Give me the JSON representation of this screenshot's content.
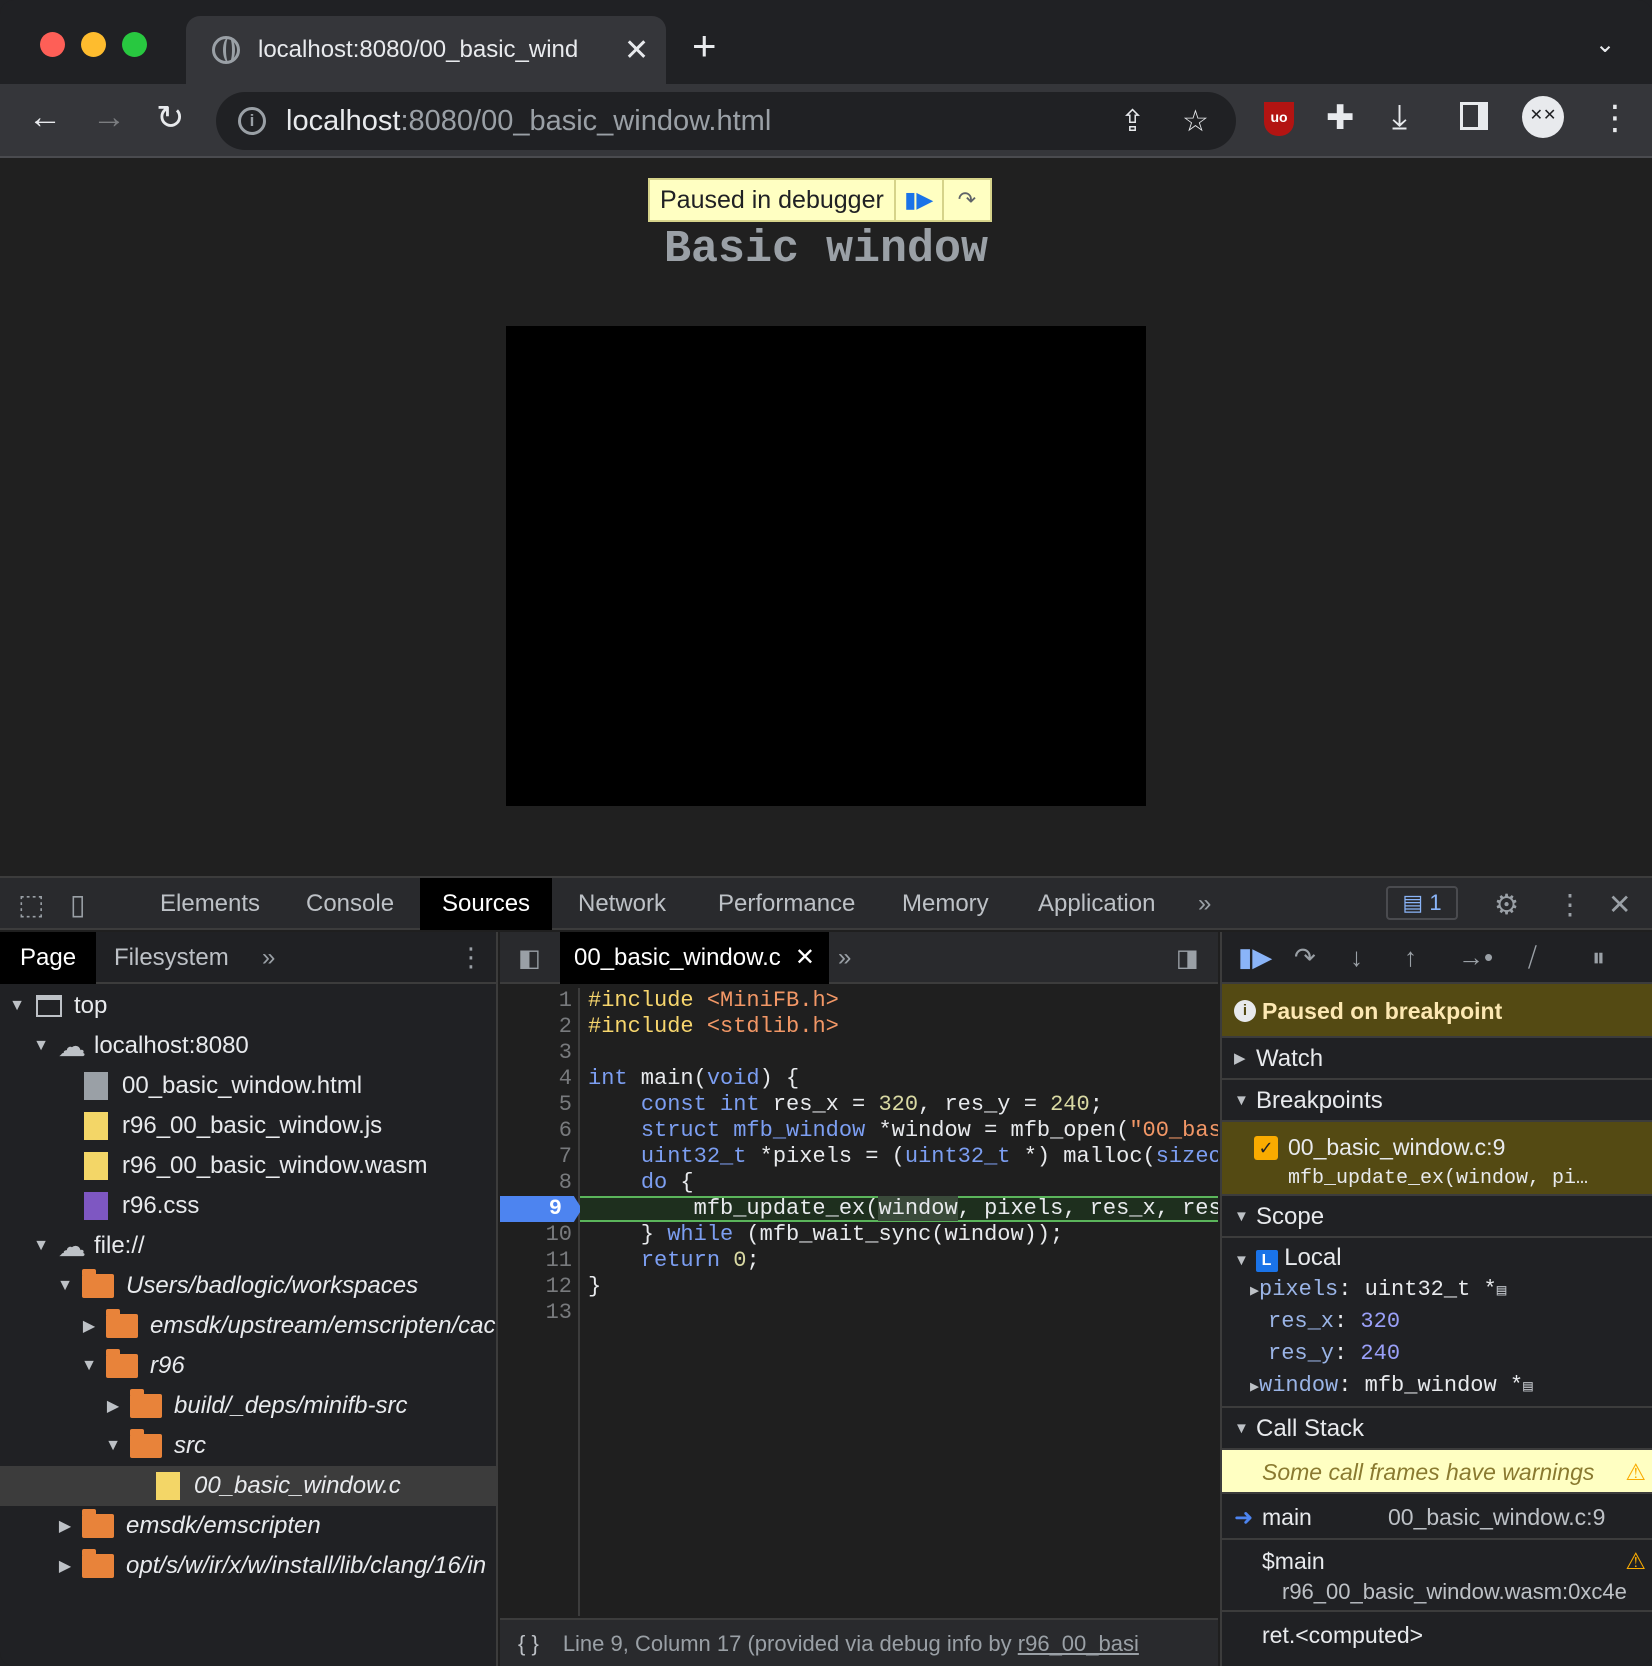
{
  "browser": {
    "tab_title": "localhost:8080/00_basic_wind",
    "url_host": "localhost",
    "url_rest": ":8080/00_basic_window.html"
  },
  "page": {
    "paused_label": "Paused in debugger",
    "title": "Basic window"
  },
  "devtools": {
    "tabs": [
      "Elements",
      "Console",
      "Sources",
      "Network",
      "Performance",
      "Memory",
      "Application"
    ],
    "issues_count": "1",
    "navigator": {
      "tabs": [
        "Page",
        "Filesystem"
      ],
      "tree": [
        {
          "label": "top"
        },
        {
          "label": "localhost:8080"
        },
        {
          "label": "00_basic_window.html"
        },
        {
          "label": "r96_00_basic_window.js"
        },
        {
          "label": "r96_00_basic_window.wasm"
        },
        {
          "label": "r96.css"
        },
        {
          "label": "file://"
        },
        {
          "label": "Users/badlogic/workspaces"
        },
        {
          "label": "emsdk/upstream/emscripten/cac"
        },
        {
          "label": "r96"
        },
        {
          "label": "build/_deps/minifb-src"
        },
        {
          "label": "src"
        },
        {
          "label": "00_basic_window.c"
        },
        {
          "label": "emsdk/emscripten"
        },
        {
          "label": "opt/s/w/ir/x/w/install/lib/clang/16/in"
        }
      ]
    },
    "editor": {
      "file_tab": "00_basic_window.c",
      "line_numbers": [
        "1",
        "2",
        "3",
        "4",
        "5",
        "6",
        "7",
        "8",
        "9",
        "10",
        "11",
        "12",
        "13"
      ],
      "status": "Line 9, Column 17  (provided via debug info by ",
      "status_link": "r96_00_basi"
    },
    "debugger": {
      "paused_msg": "Paused on breakpoint",
      "watch": "Watch",
      "breakpoints": "Breakpoints",
      "bp_file": "00_basic_window.c:9",
      "bp_code": "mfb_update_ex(window, pi…",
      "scope": "Scope",
      "local": "Local",
      "vars": [
        {
          "name": "pixels",
          "value": "uint32_t *"
        },
        {
          "name": "res_x",
          "value": "320"
        },
        {
          "name": "res_y",
          "value": "240"
        },
        {
          "name": "window",
          "value": "mfb_window *"
        }
      ],
      "callstack": "Call Stack",
      "warning": "Some call frames have warnings",
      "frames": [
        {
          "name": "main",
          "loc": "00_basic_window.c:9"
        },
        {
          "name": "$main",
          "loc": "r96_00_basic_window.wasm:0xc4e"
        },
        {
          "name": "ret.<computed>",
          "loc": ""
        }
      ]
    }
  }
}
